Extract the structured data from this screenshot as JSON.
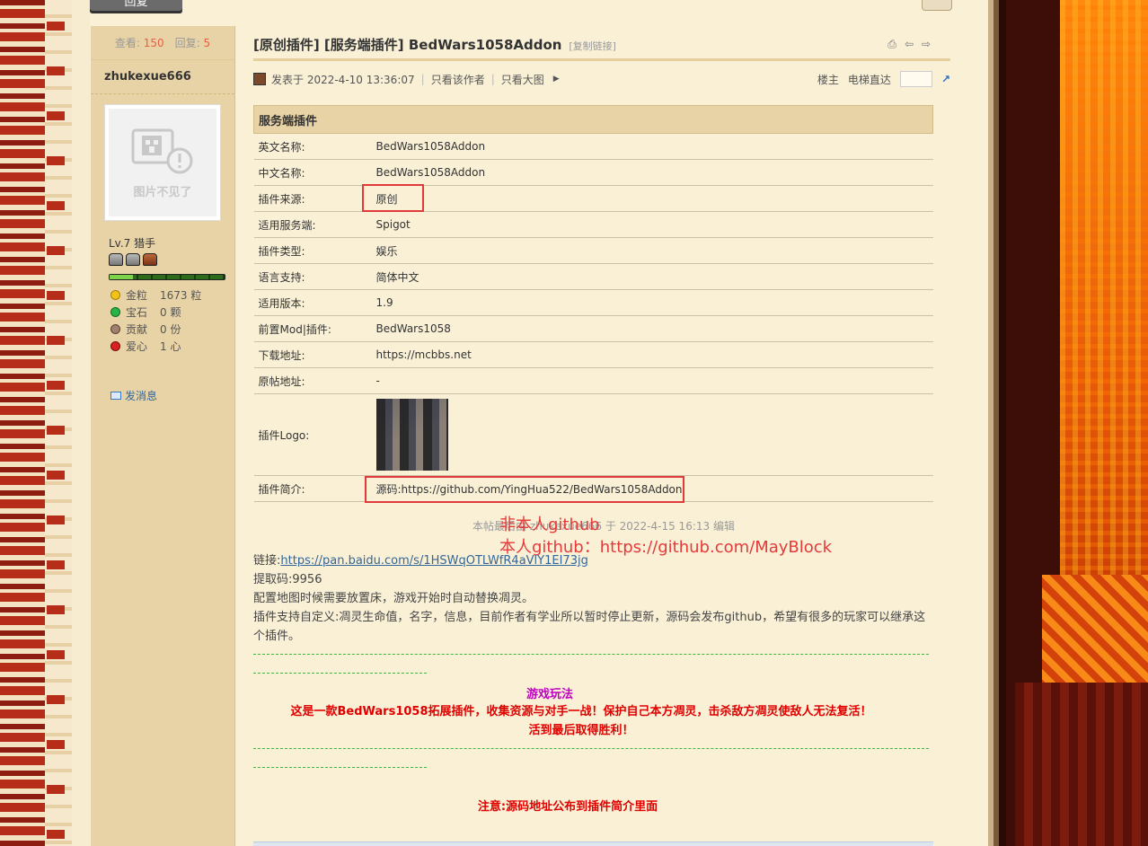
{
  "reply_button": "回复",
  "sidebar": {
    "views_label": "查看:",
    "views": "150",
    "replies_label": "回复:",
    "replies": "5",
    "author": "zhukexue666",
    "avatar_placeholder": "图片不见了",
    "level": "Lv.7 猎手",
    "exp_progress": 0.2,
    "stats": [
      {
        "label": "金粒",
        "value": "1673 粒",
        "icon": "gold-nugget-icon",
        "color": "#f2c21a"
      },
      {
        "label": "宝石",
        "value": "0 颗",
        "icon": "emerald-icon",
        "color": "#27b548"
      },
      {
        "label": "贡献",
        "value": "0 份",
        "icon": "contribution-icon",
        "color": "#a08070"
      },
      {
        "label": "爱心",
        "value": "1 心",
        "icon": "heart-apple-icon",
        "color": "#d82222"
      }
    ],
    "send_message": "发消息"
  },
  "post": {
    "title": "[原创插件] [服务端插件] BedWars1058Addon",
    "copy_link": "[复制链接]",
    "posted": "发表于 2022-4-10 13:36:07",
    "only_author": "只看该作者",
    "only_images": "只看大图",
    "floor": "楼主",
    "elevator": "电梯直达"
  },
  "table": {
    "heading": "服务端插件",
    "rows": [
      {
        "k": "英文名称:",
        "v": "BedWars1058Addon"
      },
      {
        "k": "中文名称:",
        "v": "BedWars1058Addon"
      },
      {
        "k": "插件来源:",
        "v": "原创"
      },
      {
        "k": "适用服务端:",
        "v": "Spigot"
      },
      {
        "k": "插件类型:",
        "v": "娱乐"
      },
      {
        "k": "语言支持:",
        "v": "简体中文"
      },
      {
        "k": "适用版本:",
        "v": "1.9"
      },
      {
        "k": "前置Mod|插件:",
        "v": "BedWars1058"
      },
      {
        "k": "下载地址:",
        "v": "https://mcbbs.net"
      },
      {
        "k": "原帖地址:",
        "v": "-"
      }
    ],
    "logo_label": "插件Logo:",
    "intro_label": "插件简介:",
    "intro_value": "源码:https://github.com/YingHua522/BedWars1058Addon"
  },
  "edit_note": "本帖最后由 zhukexue666 于 2022-4-15 16:13 编辑",
  "annotations": {
    "line1": "非本人github",
    "line2": "本人github：https://github.com/MayBlock"
  },
  "body": {
    "link_label": "链接:",
    "link_url": "https://pan.baidu.com/s/1HSWqOTLWfR4aVlY1EI73jg",
    "code": "提取码:9956",
    "line3": "配置地图时候需要放置床，游戏开始时自动替换凋灵。",
    "line4": "插件支持自定义:凋灵生命值，名字，信息，目前作者有学业所以暂时停止更新，源码会发布github，希望有很多的玩家可以继承这个插件。"
  },
  "gameplay": {
    "title": "游戏玩法",
    "line1": "这是一款BedWars1058拓展插件，收集资源与对手一战！保护自己本方凋灵，击杀敌方凋灵使敌人无法复活！",
    "line2": "活到最后取得胜利！"
  },
  "notice": "注意:源码地址公布到插件简介里面"
}
